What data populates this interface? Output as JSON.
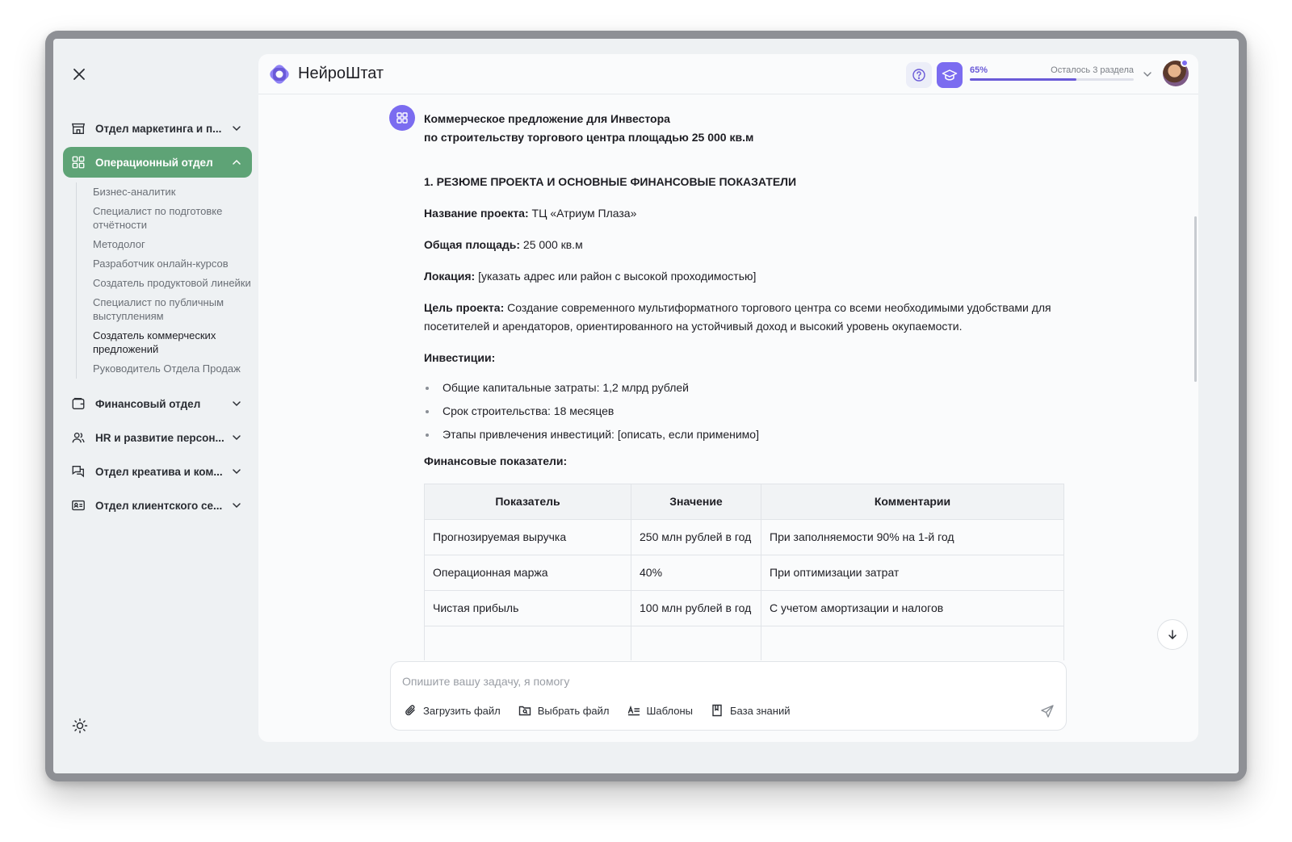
{
  "sidebar": {
    "departments": [
      {
        "label": "Отдел маркетинга и п...",
        "icon": "store-icon"
      },
      {
        "label": "Операционный отдел",
        "icon": "grid-icon",
        "active": true
      },
      {
        "label": "Финансовый отдел",
        "icon": "wallet-icon"
      },
      {
        "label": "HR и развитие персон...",
        "icon": "users-icon"
      },
      {
        "label": "Отдел креатива и ком...",
        "icon": "chat-icon"
      },
      {
        "label": "Отдел клиентского се...",
        "icon": "id-card-icon"
      }
    ],
    "sub_items": [
      "Бизнес-аналитик",
      "Специалист по подготовке отчётности",
      "Методолог",
      "Разработчик онлайн-курсов",
      "Создатель продуктовой линейки",
      "Специалист по публичным выступлениям",
      "Создатель коммерческих предложений",
      "Руководитель Отдела Продаж"
    ]
  },
  "header": {
    "brand": "НейроШтат",
    "progress_percent": "65%",
    "progress_value": 65,
    "progress_remaining": "Осталось 3 раздела",
    "accent_color": "#7b6cf0"
  },
  "doc": {
    "title_line1": "Коммерческое предложение для Инвестора",
    "title_line2": "по строительству торгового центра площадью 25 000 кв.м",
    "section_title": "1. РЕЗЮМЕ ПРОЕКТА И ОСНОВНЫЕ ФИНАНСОВЫЕ ПОКАЗАТЕЛИ",
    "project_name_label": "Название проекта:",
    "project_name_value": " ТЦ «Атриум Плаза»",
    "area_label": "Общая площадь:",
    "area_value": " 25 000 кв.м",
    "location_label": "Локация:",
    "location_value": " [указать адрес или район с высокой проходимостью]",
    "goal_label": "Цель проекта:",
    "goal_value": " Создание современного мультиформатного торгового центра со всеми необходимыми удобствами для посетителей и арендаторов, ориентированного на устойчивый доход и высокий уровень окупаемости.",
    "investments_label": "Инвестиции:",
    "investments": [
      "Общие капитальные затраты: 1,2 млрд рублей",
      "Срок строительства: 18 месяцев",
      "Этапы привлечения инвестиций: [описать, если применимо]"
    ],
    "financials_label": "Финансовые показатели:",
    "table": {
      "headers": [
        "Показатель",
        "Значение",
        "Комментарии"
      ],
      "rows": [
        [
          "Прогнозируемая выручка",
          "250 млн рублей в год",
          "При заполняемости 90% на 1-й год"
        ],
        [
          "Операционная маржа",
          "40%",
          "При оптимизации затрат"
        ],
        [
          "Чистая прибыль",
          "100 млн рублей в год",
          "С учетом амортизации и налогов"
        ]
      ]
    }
  },
  "composer": {
    "placeholder": "Опишите вашу задачу, я помогу",
    "value": "",
    "tools": [
      "Загрузить файл",
      "Выбрать файл",
      "Шаблоны",
      "База знаний"
    ]
  }
}
